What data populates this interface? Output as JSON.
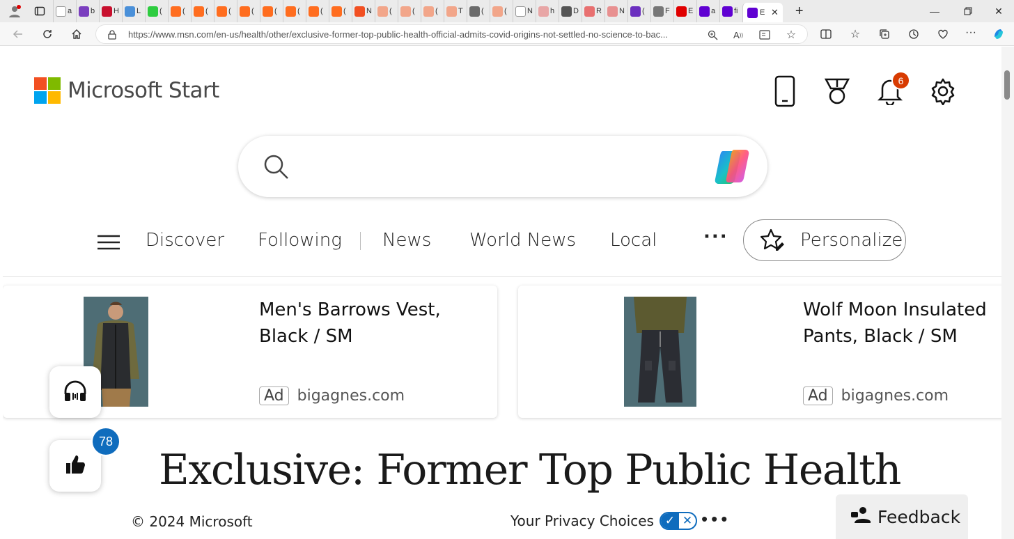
{
  "browser": {
    "tabs": [
      {
        "title": "a",
        "color": "#ffffff",
        "icon": "document-icon"
      },
      {
        "title": "b",
        "color": "#7b3fbf",
        "icon": "yahoo-icon"
      },
      {
        "title": "H",
        "color": "#c8102e",
        "icon": "app-icon"
      },
      {
        "title": "L",
        "color": "#4a90d9",
        "icon": "five-icon"
      },
      {
        "title": "(",
        "color": "#2ecc40",
        "icon": "g-icon"
      },
      {
        "title": "(",
        "color": "#ff6d1f",
        "icon": "bookmark-icon"
      },
      {
        "title": "(",
        "color": "#ff6d1f",
        "icon": "bookmark-icon"
      },
      {
        "title": "(",
        "color": "#ff6d1f",
        "icon": "bookmark-icon"
      },
      {
        "title": "(",
        "color": "#ff6d1f",
        "icon": "bookmark-icon"
      },
      {
        "title": "(",
        "color": "#ff6d1f",
        "icon": "bookmark-icon"
      },
      {
        "title": "(",
        "color": "#ff6d1f",
        "icon": "app-icon"
      },
      {
        "title": "(",
        "color": "#ff6d1f",
        "icon": "app-icon"
      },
      {
        "title": "(",
        "color": "#ff6d1f",
        "icon": "app-icon"
      },
      {
        "title": "N",
        "color": "#f25022",
        "icon": "windows-icon"
      },
      {
        "title": "(",
        "color": "#f2a68a",
        "icon": "app-icon"
      },
      {
        "title": "(",
        "color": "#f2a68a",
        "icon": "app-icon"
      },
      {
        "title": "(",
        "color": "#f2a68a",
        "icon": "app-icon"
      },
      {
        "title": "T",
        "color": "#f2a68a",
        "icon": "app-icon"
      },
      {
        "title": "(",
        "color": "#6b6b6b",
        "icon": "app-icon"
      },
      {
        "title": "(",
        "color": "#f2a68a",
        "icon": "app-icon"
      },
      {
        "title": "N",
        "color": "#ffffff",
        "icon": "bi-icon"
      },
      {
        "title": "h",
        "color": "#e8a6a6",
        "icon": "video-icon"
      },
      {
        "title": "D",
        "color": "#555555",
        "icon": "app-icon"
      },
      {
        "title": "R",
        "color": "#e87070",
        "icon": "video-icon"
      },
      {
        "title": "N",
        "color": "#e89090",
        "icon": "app-icon"
      },
      {
        "title": "(",
        "color": "#6b2fbf",
        "icon": "mail-icon"
      },
      {
        "title": "F",
        "color": "#777777",
        "icon": "app-icon"
      },
      {
        "title": "E",
        "color": "#e00000",
        "icon": "youtube-icon"
      },
      {
        "title": "a",
        "color": "#6001d2",
        "icon": "yahoo-icon"
      },
      {
        "title": "fi",
        "color": "#6001d2",
        "icon": "yahoo-icon"
      }
    ],
    "active_tab": {
      "title": "E"
    },
    "url": "https://www.msn.com/en-us/health/other/exclusive-former-top-public-health-official-admits-covid-origins-not-settled-no-science-to-bac..."
  },
  "page": {
    "brand": "Microsoft Start",
    "notification_count": "6",
    "nav": {
      "discover": "Discover",
      "following": "Following",
      "news": "News",
      "world_news": "World News",
      "local": "Local",
      "more": "···",
      "personalize": "Personalize"
    },
    "ads": [
      {
        "title": "Men's Barrows Vest, Black / SM",
        "badge": "Ad",
        "source": "bigagnes.com"
      },
      {
        "title": "Wolf Moon Insulated Pants, Black / SM",
        "badge": "Ad",
        "source": "bigagnes.com"
      }
    ],
    "like_count": "78",
    "headline": "Exclusive: Former Top Public Health",
    "footer": {
      "copyright": "© 2024 Microsoft",
      "privacy": "Your Privacy Choices",
      "more": "•••",
      "feedback": "Feedback"
    }
  },
  "colors": {
    "accent": "#0f6cbd",
    "notification_badge": "#d83b01",
    "ms_red": "#f25022",
    "ms_green": "#7fba00",
    "ms_blue": "#00a4ef",
    "ms_yellow": "#ffb900"
  }
}
